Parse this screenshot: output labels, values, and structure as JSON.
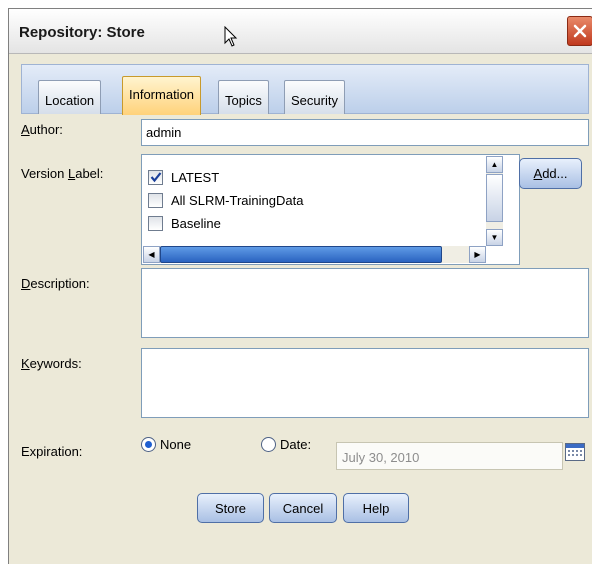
{
  "window": {
    "title": "Repository: Store"
  },
  "tabs": [
    {
      "label": "Location"
    },
    {
      "label": "Information"
    },
    {
      "label": "Topics"
    },
    {
      "label": "Security"
    }
  ],
  "active_tab": "Information",
  "form": {
    "author": {
      "label_first": "A",
      "label_rest": "uthor:",
      "value": "admin"
    },
    "version_label": {
      "label_pre": "Version ",
      "label_u": "L",
      "label_post": "abel:",
      "items": [
        {
          "label": "LATEST",
          "checked": true
        },
        {
          "label": "All SLRM-TrainingData",
          "checked": false
        },
        {
          "label": "Baseline",
          "checked": false
        }
      ],
      "add_button_u": "A",
      "add_button_rest": "dd..."
    },
    "description": {
      "label_u": "D",
      "label_rest": "escription:",
      "value": ""
    },
    "keywords": {
      "label_u": "K",
      "label_rest": "eywords:",
      "value": ""
    },
    "expiration": {
      "label": "Expiration:",
      "none_label": "None",
      "date_label": "Date:",
      "date_value": "July 30, 2010",
      "selected": "None"
    }
  },
  "buttons": {
    "store": "Store",
    "cancel": "Cancel",
    "help": "Help"
  },
  "colors": {
    "active_tab": "#ffd27a",
    "button": "#a9c0e4",
    "close": "#c0391e"
  }
}
